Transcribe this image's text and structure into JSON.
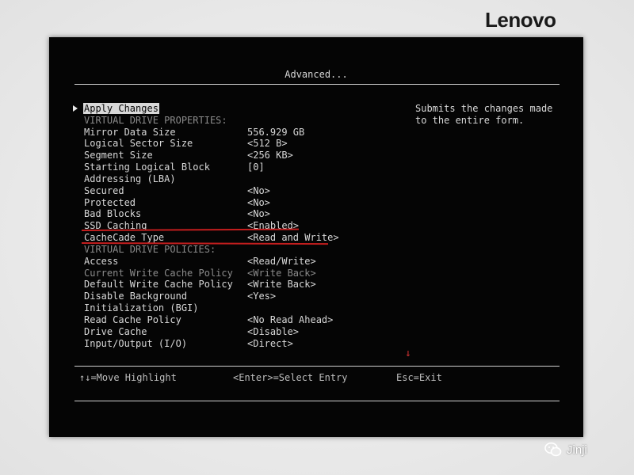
{
  "brand": {
    "logo_text": "Lenovo"
  },
  "screen": {
    "title": "Advanced...",
    "rows": [
      {
        "label": "Apply Changes",
        "value": "",
        "kind": "highlight"
      },
      {
        "label": "VIRTUAL DRIVE PROPERTIES:",
        "value": "",
        "kind": "section"
      },
      {
        "label": "Mirror Data Size",
        "value": "556.929 GB",
        "kind": "normal"
      },
      {
        "label": "Logical Sector Size",
        "value": "<512 B>",
        "kind": "normal"
      },
      {
        "label": "Segment Size",
        "value": "<256 KB>",
        "kind": "normal"
      },
      {
        "label": "Starting Logical Block",
        "value": "[0]",
        "kind": "normal"
      },
      {
        "label": "Addressing (LBA)",
        "value": "",
        "kind": "normal"
      },
      {
        "label": "Secured",
        "value": "<No>",
        "kind": "normal"
      },
      {
        "label": "Protected",
        "value": "<No>",
        "kind": "normal"
      },
      {
        "label": "Bad Blocks",
        "value": "<No>",
        "kind": "normal"
      },
      {
        "label": "SSD Caching",
        "value": "<Enabled>",
        "kind": "normal"
      },
      {
        "label": "CacheCade Type",
        "value": "<Read and Write>",
        "kind": "normal"
      },
      {
        "label": "VIRTUAL DRIVE POLICIES:",
        "value": "",
        "kind": "section"
      },
      {
        "label": "Access",
        "value": "<Read/Write>",
        "kind": "normal"
      },
      {
        "label": "Current Write Cache Policy",
        "value": "<Write Back>",
        "kind": "disabled"
      },
      {
        "label": "Default Write Cache Policy",
        "value": "<Write Back>",
        "kind": "normal"
      },
      {
        "label": "Disable Background",
        "value": "<Yes>",
        "kind": "normal"
      },
      {
        "label": "Initialization (BGI)",
        "value": "",
        "kind": "normal"
      },
      {
        "label": "Read Cache Policy",
        "value": "<No Read Ahead>",
        "kind": "normal"
      },
      {
        "label": "Drive Cache",
        "value": "<Disable>",
        "kind": "normal"
      },
      {
        "label": "Input/Output (I/O)",
        "value": "<Direct>",
        "kind": "normal"
      }
    ],
    "help_text": "Submits the changes made to the entire form.",
    "scroll_indicator": "↓",
    "footer": {
      "move": "↑↓=Move Highlight",
      "select": "<Enter>=Select Entry",
      "exit": "Esc=Exit"
    }
  },
  "watermark": {
    "text": "Jinji",
    "icon": "wechat-icon"
  },
  "colors": {
    "screen_bg": "#050505",
    "text": "#d8d8d8",
    "dim_text": "#8b8b8b",
    "annotation": "#c41e1e",
    "scroll_arrow": "#d23232"
  }
}
